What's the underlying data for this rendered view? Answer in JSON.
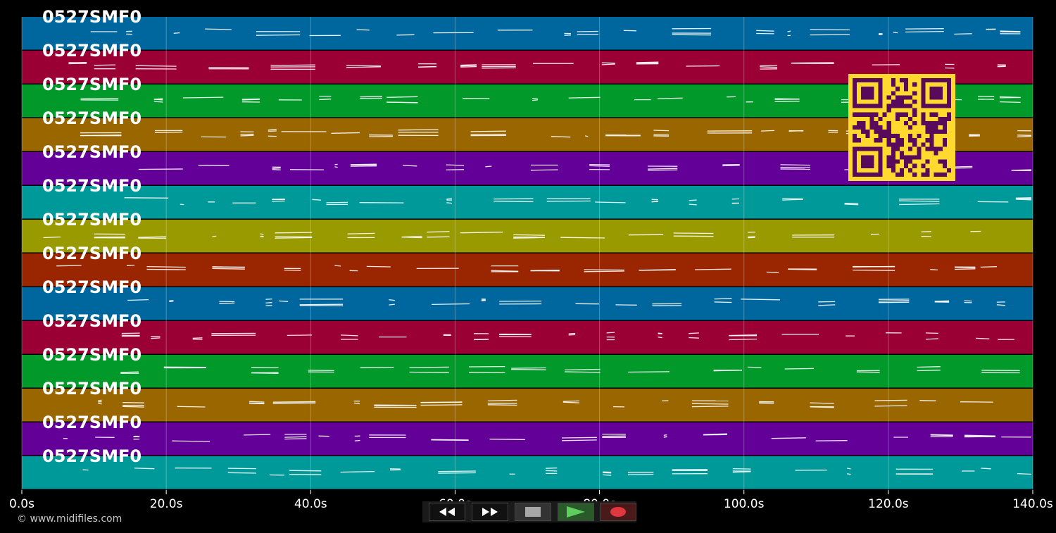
{
  "window": {
    "background": "#000000"
  },
  "roll": {
    "x_axis_min": 0,
    "x_axis_max": 140,
    "tick_labels": [
      "0.0s",
      "20.0s",
      "40.0s",
      "60.0s",
      "80.0s",
      "100.0s",
      "120.0s",
      "140.0s"
    ],
    "tick_values": [
      0,
      20,
      40,
      60,
      80,
      100,
      120,
      140
    ]
  },
  "tracks": [
    {
      "label": "0527SMF0",
      "color": "#00679e"
    },
    {
      "label": "0527SMF0",
      "color": "#9a0033"
    },
    {
      "label": "0527SMF0",
      "color": "#00992a"
    },
    {
      "label": "0527SMF0",
      "color": "#996600"
    },
    {
      "label": "0527SMF0",
      "color": "#620097"
    },
    {
      "label": "0527SMF0",
      "color": "#009999"
    },
    {
      "label": "0527SMF0",
      "color": "#999900"
    },
    {
      "label": "0527SMF0",
      "color": "#992600"
    },
    {
      "label": "0527SMF0",
      "color": "#00679e"
    },
    {
      "label": "0527SMF0",
      "color": "#9a0033"
    },
    {
      "label": "0527SMF0",
      "color": "#00992a"
    },
    {
      "label": "0527SMF0",
      "color": "#996600"
    },
    {
      "label": "0527SMF0",
      "color": "#620097"
    },
    {
      "label": "0527SMF0",
      "color": "#009999"
    }
  ],
  "qr": {
    "foreground": "#ffd92e",
    "module_color": "#5a0a5a",
    "icon": "qr-code-icon"
  },
  "footer": {
    "copyright": "© www.midifiles.com"
  },
  "controls": {
    "rewind_icon": "rewind-icon",
    "fast_forward_icon": "fast-forward-icon",
    "stop_icon": "stop-icon",
    "play_icon": "play-icon",
    "record_icon": "record-icon",
    "play_color": "#5fce5f",
    "record_color": "#e0383e"
  }
}
